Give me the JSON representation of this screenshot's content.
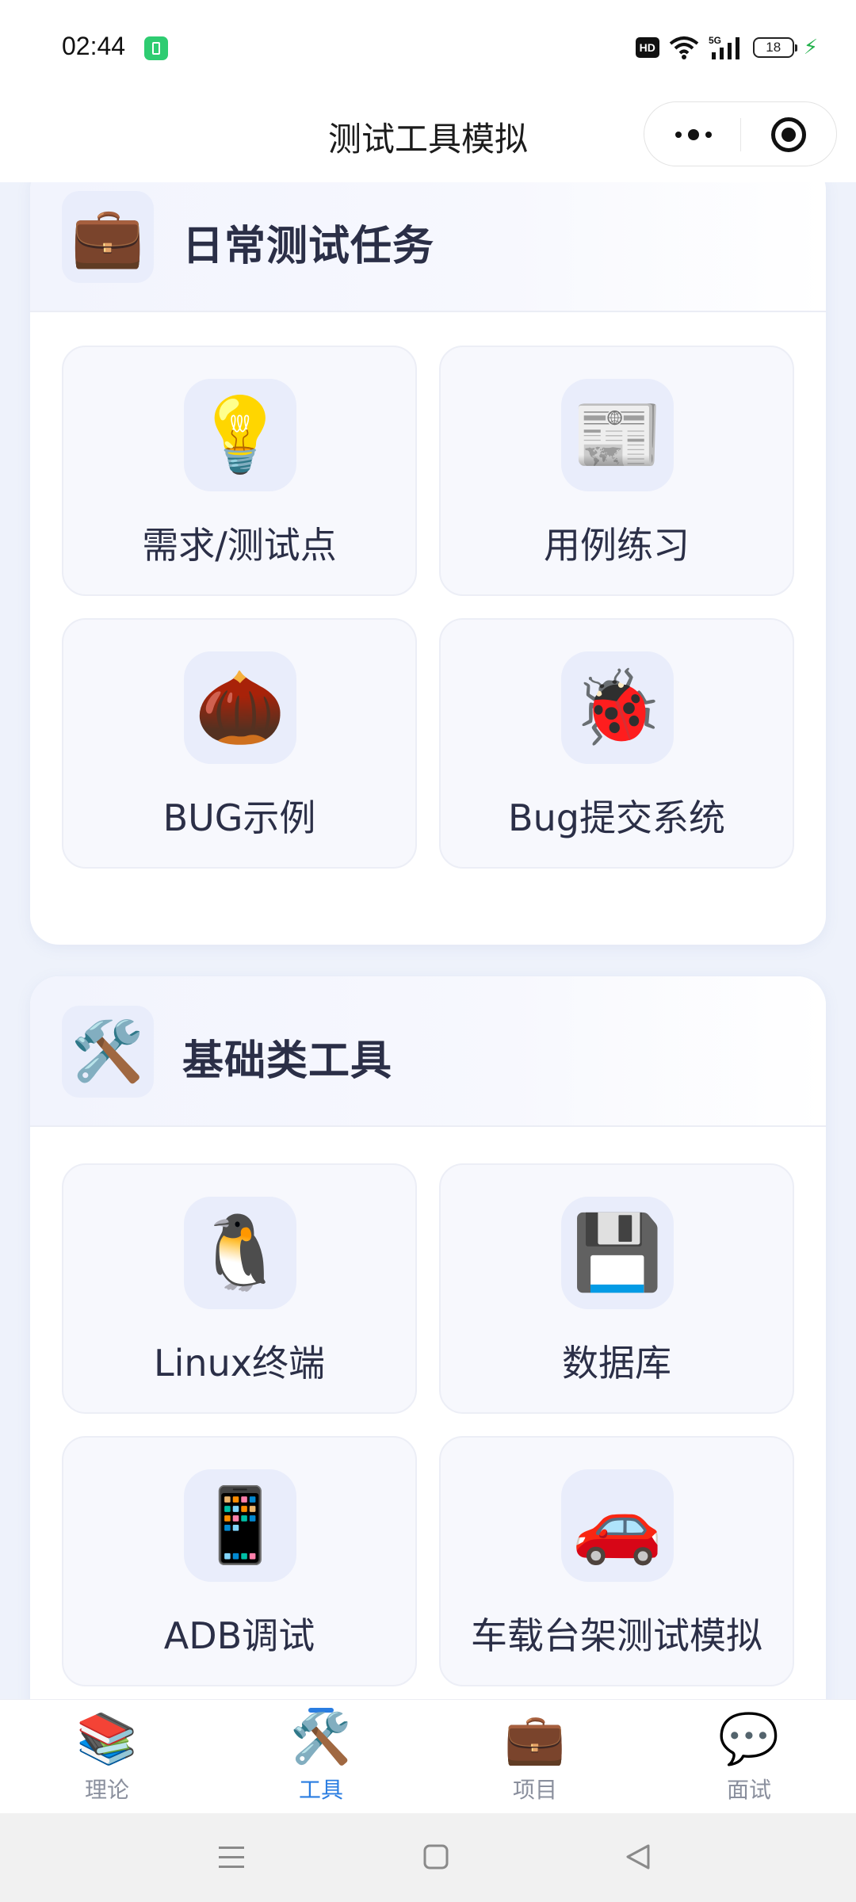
{
  "status_bar": {
    "time": "02:44",
    "network_label": "5G",
    "hd_label": "HD",
    "battery_level": "18"
  },
  "title_bar": {
    "title": "测试工具模拟"
  },
  "sections": [
    {
      "title": "日常测试任务",
      "icon": "briefcase-icon",
      "icon_glyph": "💼",
      "items": [
        {
          "label": "需求/测试点",
          "icon": "light-bulb-icon",
          "icon_glyph": "💡"
        },
        {
          "label": "用例练习",
          "icon": "newspaper-icon",
          "icon_glyph": "📰"
        },
        {
          "label": "BUG示例",
          "icon": "chestnut-icon",
          "icon_glyph": "🌰"
        },
        {
          "label": "Bug提交系统",
          "icon": "ladybug-icon",
          "icon_glyph": "🐞"
        }
      ]
    },
    {
      "title": "基础类工具",
      "icon": "hammer-wrench-icon",
      "icon_glyph": "🛠️",
      "items": [
        {
          "label": "Linux终端",
          "icon": "penguin-icon",
          "icon_glyph": "🐧"
        },
        {
          "label": "数据库",
          "icon": "floppy-disk-icon",
          "icon_glyph": "💾"
        },
        {
          "label": "ADB调试",
          "icon": "mobile-phone-icon",
          "icon_glyph": "📱"
        },
        {
          "label": "车载台架测试模拟",
          "icon": "car-icon",
          "icon_glyph": "🚗"
        }
      ]
    }
  ],
  "tab_bar": {
    "active_index": 1,
    "active_color": "#2a7de1",
    "inactive_color": "#8a8f9d",
    "tabs": [
      {
        "label": "理论",
        "icon": "books-icon",
        "icon_glyph": "📚"
      },
      {
        "label": "工具",
        "icon": "hammer-wrench-icon",
        "icon_glyph": "🛠️"
      },
      {
        "label": "项目",
        "icon": "briefcase-icon",
        "icon_glyph": "💼"
      },
      {
        "label": "面试",
        "icon": "speech-bubble-icon",
        "icon_glyph": "💬"
      }
    ]
  }
}
